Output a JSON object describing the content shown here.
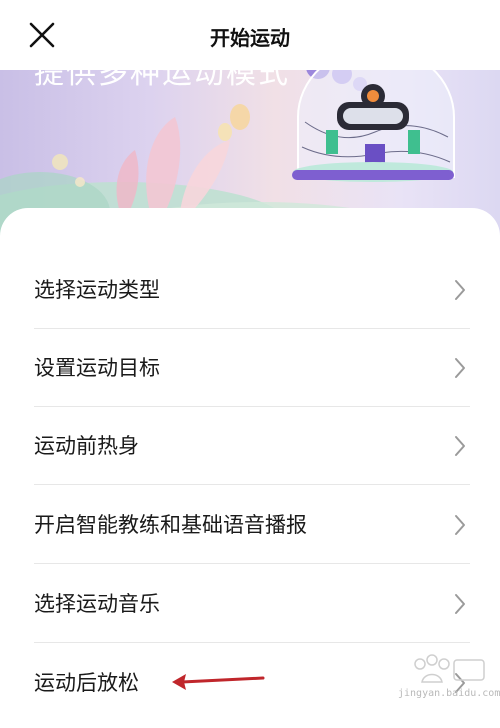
{
  "header": {
    "title": "开始运动",
    "close_icon": "close-icon"
  },
  "banner": {
    "text": "提供多种运动模式"
  },
  "menu": {
    "items": [
      {
        "label": "选择运动类型",
        "icon": "chevron-right-icon"
      },
      {
        "label": "设置运动目标",
        "icon": "chevron-right-icon"
      },
      {
        "label": "运动前热身",
        "icon": "chevron-right-icon"
      },
      {
        "label": "开启智能教练和基础语音播报",
        "icon": "chevron-right-icon"
      },
      {
        "label": "选择运动音乐",
        "icon": "chevron-right-icon"
      },
      {
        "label": "运动后放松",
        "icon": "chevron-right-icon"
      }
    ]
  },
  "annotation": {
    "arrow_color": "#c0262b"
  },
  "watermark": {
    "logo": "Baidu 经验",
    "text": "jingyan.baidu.com"
  },
  "colors": {
    "text": "#1a1a1a",
    "divider": "#e7e7e7",
    "chevron": "#9a9a9a"
  }
}
